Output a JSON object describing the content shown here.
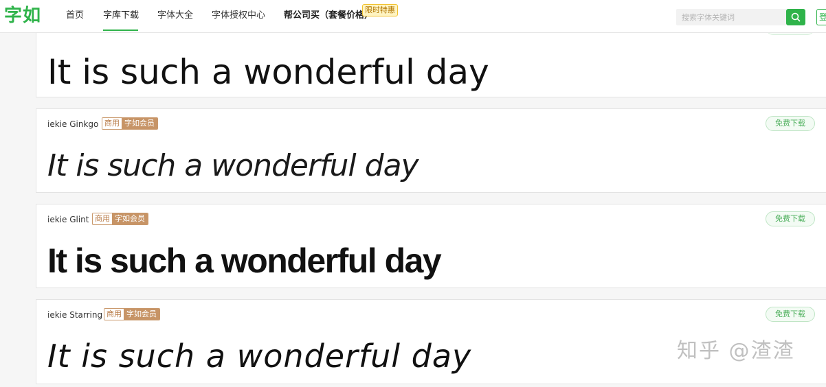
{
  "header": {
    "logo": "字如",
    "nav": [
      "首页",
      "字库下载",
      "字体大全",
      "字体授权中心",
      "帮公司买（套餐价格）"
    ],
    "hot_badge": "限时特惠",
    "search_placeholder": "搜索字体关键词",
    "login": "登"
  },
  "cards": [
    {
      "name": "",
      "sample": "It is such a wonderful day"
    },
    {
      "name": "iekie Ginkgo",
      "tag_commercial": "商用",
      "tag_member": "字如会员",
      "download": "免费下载",
      "sample": "It is such a wonderful day"
    },
    {
      "name": "iekie Glint",
      "tag_commercial": "商用",
      "tag_member": "字如会员",
      "download": "免费下载",
      "sample": "It is such a wonderful day"
    },
    {
      "name": "iekie Starring",
      "tag_commercial": "商用",
      "tag_member": "字如会员",
      "download": "免费下载",
      "sample": "It is such a wonderful day"
    }
  ],
  "watermark": "知乎 @渣渣",
  "colors": {
    "brand_green": "#2fb34a",
    "tag_gold": "#c79466",
    "hot_badge": "#f2c230"
  }
}
